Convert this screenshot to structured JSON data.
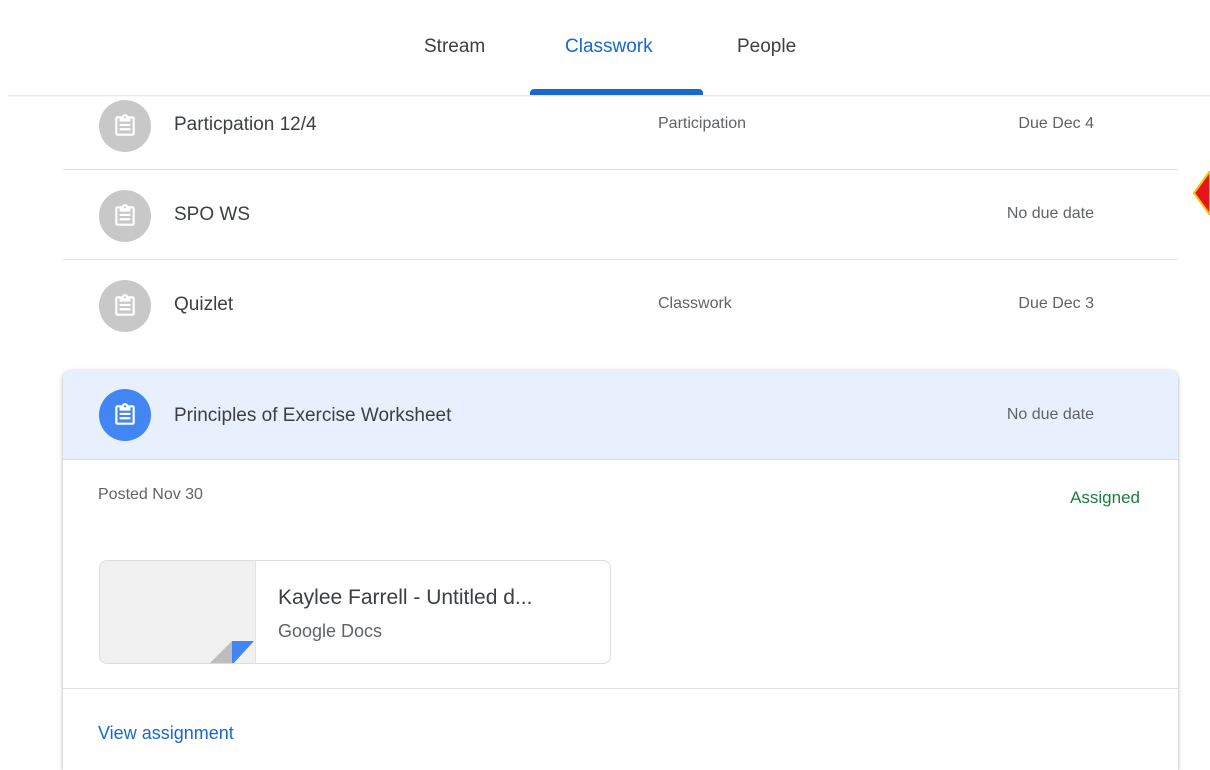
{
  "tabs": [
    {
      "label": "Stream"
    },
    {
      "label": "Classwork"
    },
    {
      "label": "People"
    }
  ],
  "assignments": [
    {
      "title": "Particpation 12/4",
      "topic": "Participation",
      "due": "Due Dec 4"
    },
    {
      "title": "SPO WS",
      "topic": "",
      "due": "No due date"
    },
    {
      "title": "Quizlet",
      "topic": "Classwork",
      "due": "Due Dec 3"
    }
  ],
  "expanded": {
    "title": "Principles of Exercise Worksheet",
    "due": "No due date",
    "posted": "Posted Nov 30",
    "status": "Assigned",
    "attachment": {
      "title": "Kaylee Farrell - Untitled d...",
      "type": "Google Docs"
    },
    "view_link": "View assignment"
  },
  "colors": {
    "accent": "#1967d2",
    "assigned": "#188038",
    "icon_inactive": "#c8c8c8",
    "icon_active": "#4285f4",
    "selected_bg": "#e8f0fe"
  },
  "icons": {
    "assignment": "assignment-clipboard-icon",
    "doc_corner": "google-docs-corner-icon",
    "marker": "red-diamond-marker"
  }
}
